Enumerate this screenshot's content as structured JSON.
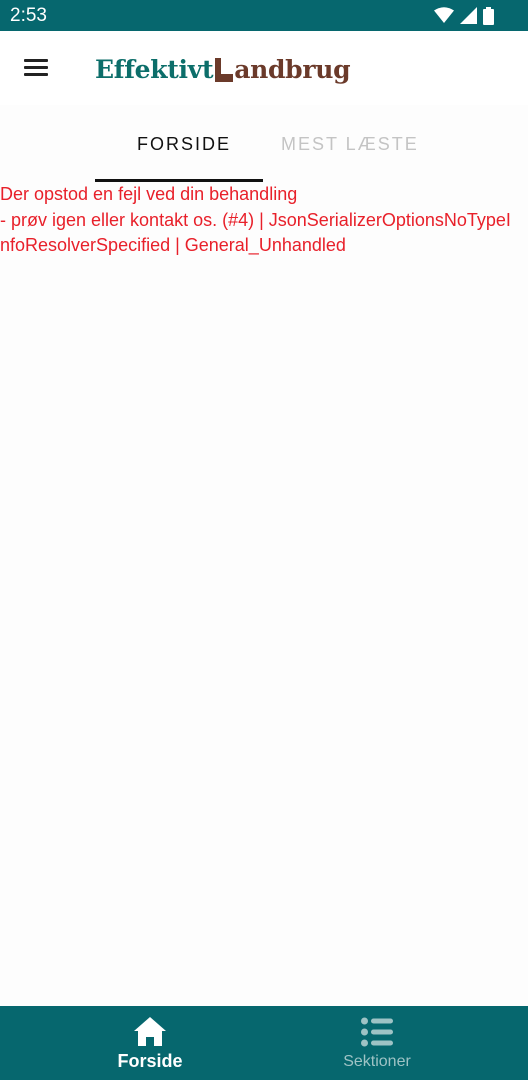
{
  "status_bar": {
    "time": "2:53",
    "icons": [
      "wifi-icon",
      "cell-signal-icon",
      "battery-icon"
    ]
  },
  "app_bar": {
    "menu_icon": "hamburger-menu-icon",
    "logo": {
      "part1": "Effektivt",
      "part2": "andbrug"
    }
  },
  "tabs": [
    {
      "label": "FORSIDE",
      "selected": true
    },
    {
      "label": "MEST LÆSTE",
      "selected": false
    }
  ],
  "error": {
    "message": "Der opstod en fejl ved din behandling\n- prøv igen eller kontakt os. (#4) | JsonSerializerOptionsNoTypeInfoResolverSpecified | General_Unhandled"
  },
  "bottom_nav": {
    "items": [
      {
        "label": "Forside",
        "icon": "home-icon",
        "active": true
      },
      {
        "label": "Sektioner",
        "icon": "list-icon",
        "active": false
      }
    ]
  },
  "colors": {
    "primary": "#06676e",
    "logo_green": "#0c6e6a",
    "logo_brown": "#6b3a2a",
    "error": "#e8202a",
    "tab_inactive": "#c4c4c4"
  }
}
